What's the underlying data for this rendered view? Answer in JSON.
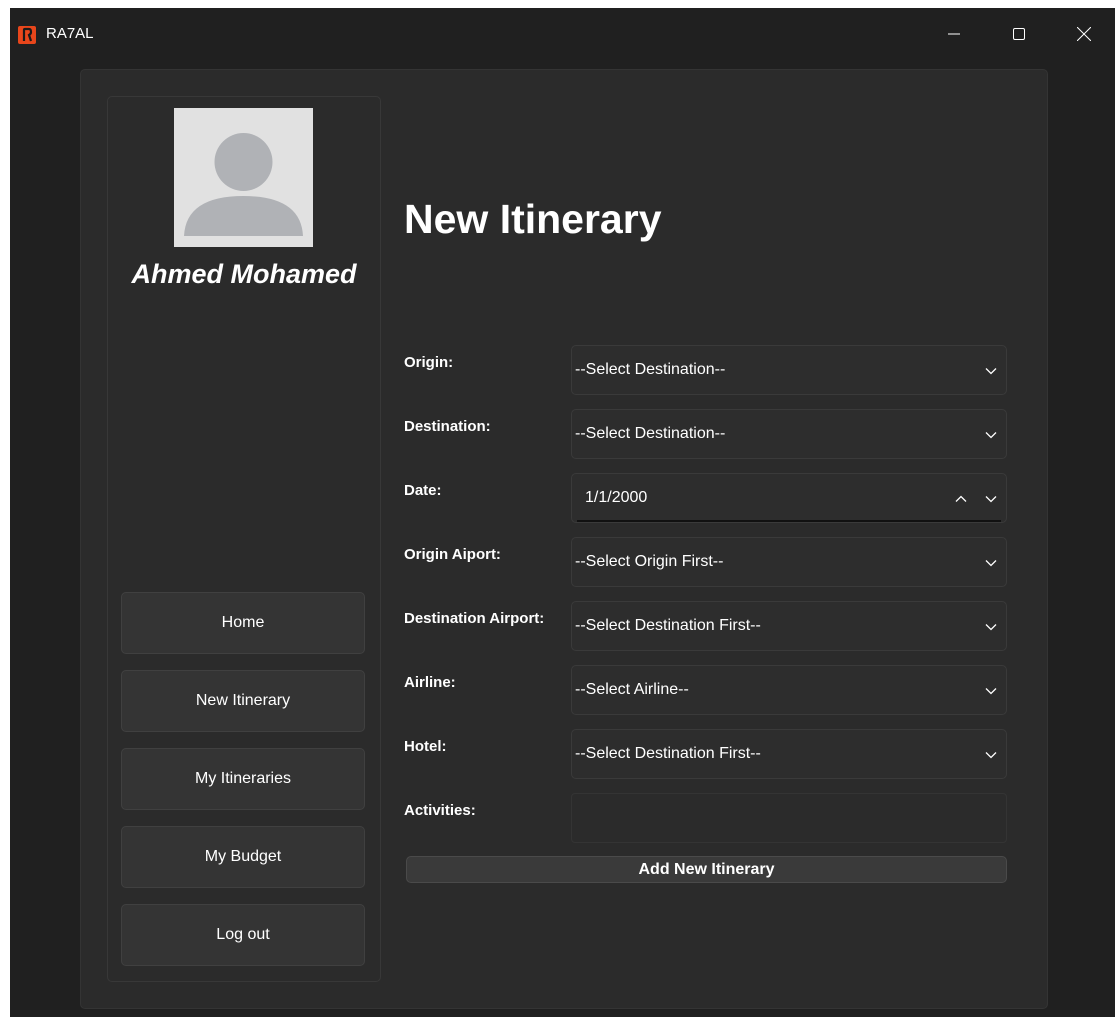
{
  "window": {
    "title": "RA7AL",
    "logo_color": "#e8461b"
  },
  "user": {
    "name": "Ahmed Mohamed",
    "avatar_icon": "user-avatar-icon"
  },
  "nav": {
    "items": [
      {
        "label": "Home"
      },
      {
        "label": "New Itinerary"
      },
      {
        "label": "My Itineraries"
      },
      {
        "label": "My Budget"
      },
      {
        "label": "Log out"
      }
    ]
  },
  "page": {
    "title": "New Itinerary"
  },
  "form": {
    "origin": {
      "label": "Origin:",
      "value": "--Select Destination--"
    },
    "destination": {
      "label": "Destination:",
      "value": "--Select Destination--"
    },
    "date": {
      "label": "Date:",
      "value": "1/1/2000"
    },
    "origin_airport": {
      "label": "Origin Aiport:",
      "value": "--Select Origin First--"
    },
    "destination_airport": {
      "label": "Destination Airport:",
      "value": "--Select Destination First--"
    },
    "airline": {
      "label": "Airline:",
      "value": "--Select Airline--"
    },
    "hotel": {
      "label": "Hotel:",
      "value": "--Select Destination First--"
    },
    "activities": {
      "label": "Activities:",
      "value": ""
    },
    "submit_label": "Add New Itinerary"
  },
  "colors": {
    "window_bg": "#202020",
    "panel_bg": "#2b2b2b",
    "button_bg": "#343434"
  }
}
